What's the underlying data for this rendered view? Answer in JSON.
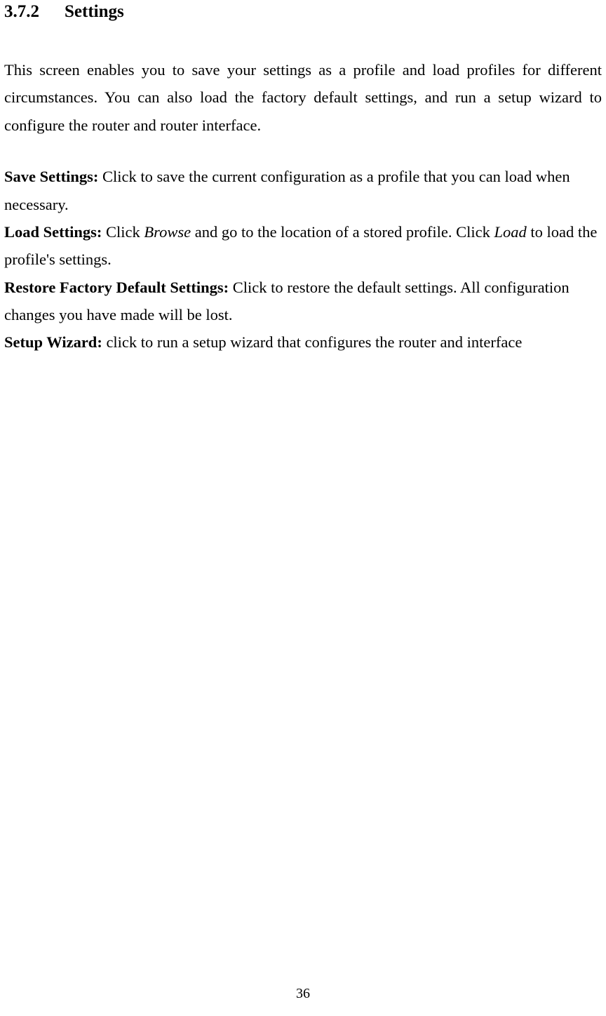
{
  "heading": {
    "number": "3.7.2",
    "title": "Settings"
  },
  "intro": "This screen enables you to save your settings as a profile and load profiles for different circumstances. You can also load the factory default settings, and run a setup wizard to configure the router and router interface.",
  "items": {
    "save": {
      "label": "Save Settings:",
      "text": " Click to save the current configuration as a profile that you can load when necessary."
    },
    "load": {
      "label": "Load Settings:",
      "pre": " Click ",
      "browse": "Browse",
      "mid": " and go to the location of a stored profile. Click ",
      "loadword": "Load",
      "post": " to load the profile's settings."
    },
    "restore": {
      "label": "Restore Factory Default Settings:",
      "text": " Click to restore the default settings. All configuration changes you have made will be lost."
    },
    "wizard": {
      "label": "Setup Wizard:",
      "text": " click to run a setup wizard that configures the router and interface"
    }
  },
  "pageNumber": "36"
}
